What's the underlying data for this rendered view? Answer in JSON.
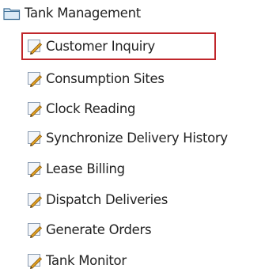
{
  "tree": {
    "folder": {
      "label": "Tank Management",
      "icon": "folder-icon"
    },
    "items": [
      {
        "label": "Customer Inquiry",
        "icon": "edit-document-icon",
        "selected": true
      },
      {
        "label": "Consumption Sites",
        "icon": "edit-document-icon",
        "selected": false
      },
      {
        "label": "Clock Reading",
        "icon": "edit-document-icon",
        "selected": false
      },
      {
        "label": "Synchronize Delivery History",
        "icon": "edit-document-icon",
        "selected": false
      },
      {
        "label": "Lease Billing",
        "icon": "edit-document-icon",
        "selected": false
      },
      {
        "label": "Dispatch Deliveries",
        "icon": "edit-document-icon",
        "selected": false
      },
      {
        "label": "Generate Orders",
        "icon": "edit-document-icon",
        "selected": false
      },
      {
        "label": "Tank Monitor",
        "icon": "edit-document-icon",
        "selected": false
      }
    ]
  },
  "colors": {
    "selection_border": "#c0262b",
    "folder_fill": "#dbeaf6",
    "folder_stroke": "#3e6f96",
    "pencil": "#e0a020"
  }
}
